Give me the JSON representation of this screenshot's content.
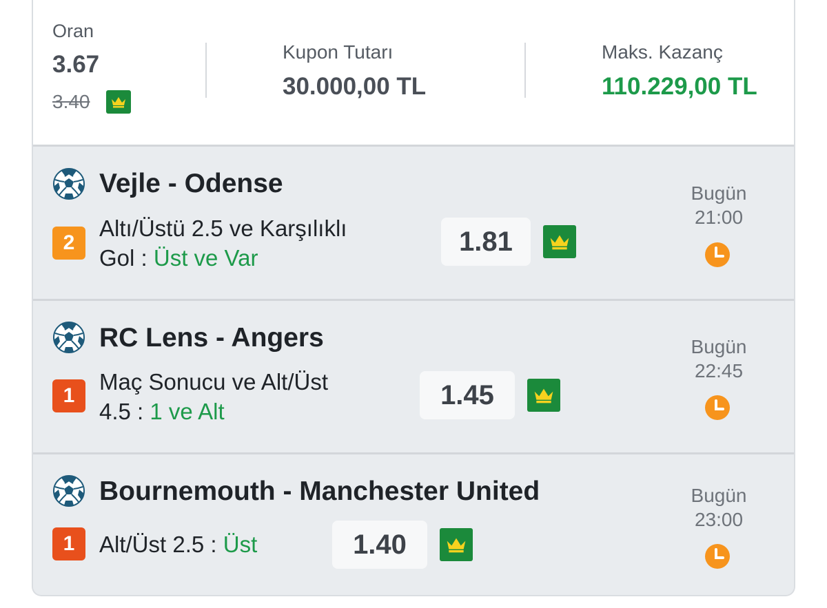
{
  "summary": {
    "oran_label": "Oran",
    "oran_value": "3.67",
    "oran_old": "3.40",
    "kupon_label": "Kupon Tutarı",
    "kupon_value": "30.000,00 TL",
    "maks_label": "Maks. Kazanç",
    "maks_value": "110.229,00 TL"
  },
  "matches": [
    {
      "title": "Vejle - Odense",
      "badge": "2",
      "badge_color": "#f7941d",
      "market_line1": "Altı/Üstü 2.5 ve Karşılıklı",
      "market_line2": "Gol : ",
      "pick": "Üst ve Var",
      "odd": "1.81",
      "day": "Bugün",
      "time": "21:00"
    },
    {
      "title": "RC Lens - Angers",
      "badge": "1",
      "badge_color": "#e8501c",
      "market_line1": "Maç Sonucu ve Alt/Üst",
      "market_line2": "4.5 : ",
      "pick": "1 ve Alt",
      "odd": "1.45",
      "day": "Bugün",
      "time": "22:45"
    },
    {
      "title": "Bournemouth - Manchester United",
      "badge": "1",
      "badge_color": "#e8501c",
      "market_line1": "Alt/Üst 2.5 : ",
      "pick": "Üst",
      "odd": "1.40",
      "day": "Bugün",
      "time": "23:00"
    }
  ],
  "colors": {
    "green": "#1d9a4a",
    "crown_bg": "#1b8a3b",
    "crown": "#f6d21e",
    "clock": "#f7941d"
  },
  "icons": [
    "crown-icon",
    "soccer-ball-icon",
    "clock-icon"
  ]
}
